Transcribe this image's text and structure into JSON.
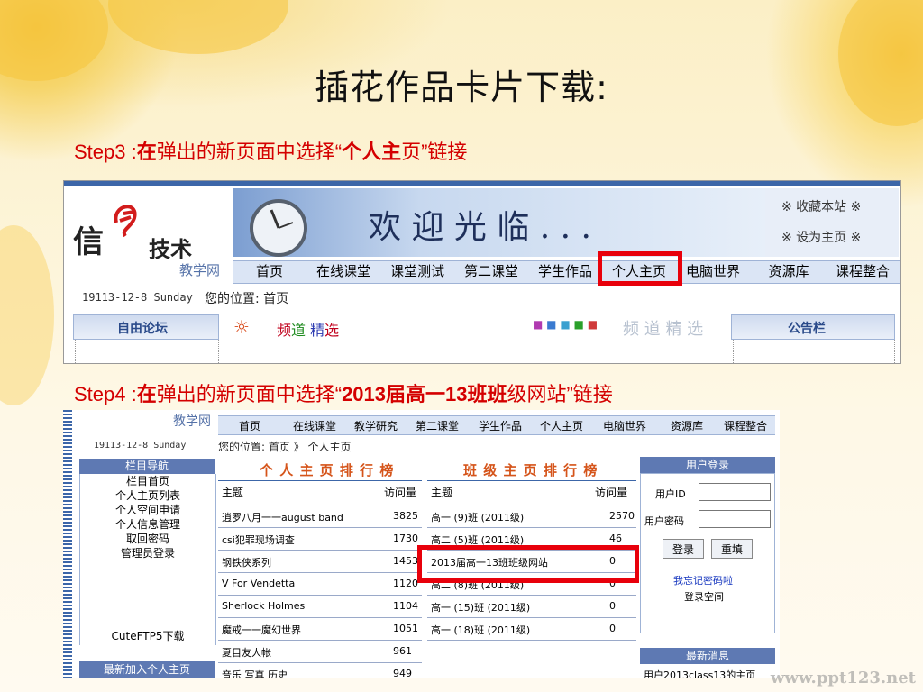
{
  "slide": {
    "title": "插花作品卡片下载:",
    "step3": {
      "prefix": "Step3 :",
      "a": "在",
      "b": "弹出的新页面中选择“",
      "c": "个人主",
      "d": "页”链接"
    },
    "step4": {
      "prefix": "Step4 :",
      "a": "在",
      "b": "弹出的新页面中选择“",
      "c": "2013届高一13班班",
      "d": "级网站”链接"
    },
    "watermark": "www.ppt123.net"
  },
  "shot1": {
    "logo_a": "信",
    "logo_b": "技术",
    "logo_sub": "教学网",
    "welcome": "欢 迎 光 临 . . .",
    "bookmark": "※ 收藏本站 ※",
    "sethome": "※ 设为主页 ※",
    "nav": [
      "首页",
      "在线课堂",
      "课堂测试",
      "第二课堂",
      "学生作品",
      "个人主页",
      "电脑世界",
      "资源库",
      "课程整合"
    ],
    "date": "19113-12-8 Sunday",
    "location": "您的位置: 首页",
    "forum": "自由论坛",
    "channel_a": "频",
    "channel_b": "道",
    "channel_c": "精",
    "channel_d": "选",
    "channel_gray": "频 道 精 选",
    "notice": "公告栏"
  },
  "shot2": {
    "logo_sub": "教学网",
    "nav": [
      "首页",
      "在线课堂",
      "教学研究",
      "第二课堂",
      "学生作品",
      "个人主页",
      "电脑世界",
      "资源库",
      "课程整合"
    ],
    "date": "19113-12-8 Sunday",
    "location": "您的位置: 首页 》 个人主页",
    "side_title": "栏目导航",
    "side_items": [
      "栏目首页",
      "个人主页列表",
      "个人空间申请",
      "个人信息管理",
      "取回密码",
      "管理员登录"
    ],
    "cuteftp": "CuteFTP5下载",
    "side_new": "最新加入个人主页",
    "personal": {
      "title": "个 人 主 页 排 行 榜",
      "col1": "主题",
      "col2": "访问量",
      "rows": [
        [
          "逍罗八月一一august band",
          "3825"
        ],
        [
          "csi犯罪现场调查",
          "1730"
        ],
        [
          "钢铁侠系列",
          "1453"
        ],
        [
          "V For Vendetta",
          "1120"
        ],
        [
          "Sherlock Holmes",
          "1104"
        ],
        [
          "魔戒一一魔幻世界",
          "1051"
        ],
        [
          "夏目友人帐",
          "961"
        ],
        [
          "音乐 写真 历史",
          "949"
        ]
      ]
    },
    "class": {
      "title": "班 级 主 页 排 行 榜",
      "col1": "主题",
      "col2": "访问量",
      "rows": [
        [
          "高一 (9)班 (2011级)",
          "2570"
        ],
        [
          "高二 (5)班 (2011级)",
          "46"
        ],
        [
          "2013届高一13班班级网站",
          "0"
        ],
        [
          "高二 (8)班 (2011级)",
          "0"
        ],
        [
          "高一 (15)班 (2011级)",
          "0"
        ],
        [
          "高一 (18)班 (2011级)",
          "0"
        ]
      ]
    },
    "login": {
      "title": "用户登录",
      "uid_label": "用户ID",
      "pwd_label": "用户密码",
      "login_btn": "登录",
      "reset_btn": "重填",
      "forgot": "我忘记密码啦",
      "space": "登录空间"
    },
    "news": {
      "title": "最新消息",
      "item": "用户2013class13的主页"
    }
  }
}
